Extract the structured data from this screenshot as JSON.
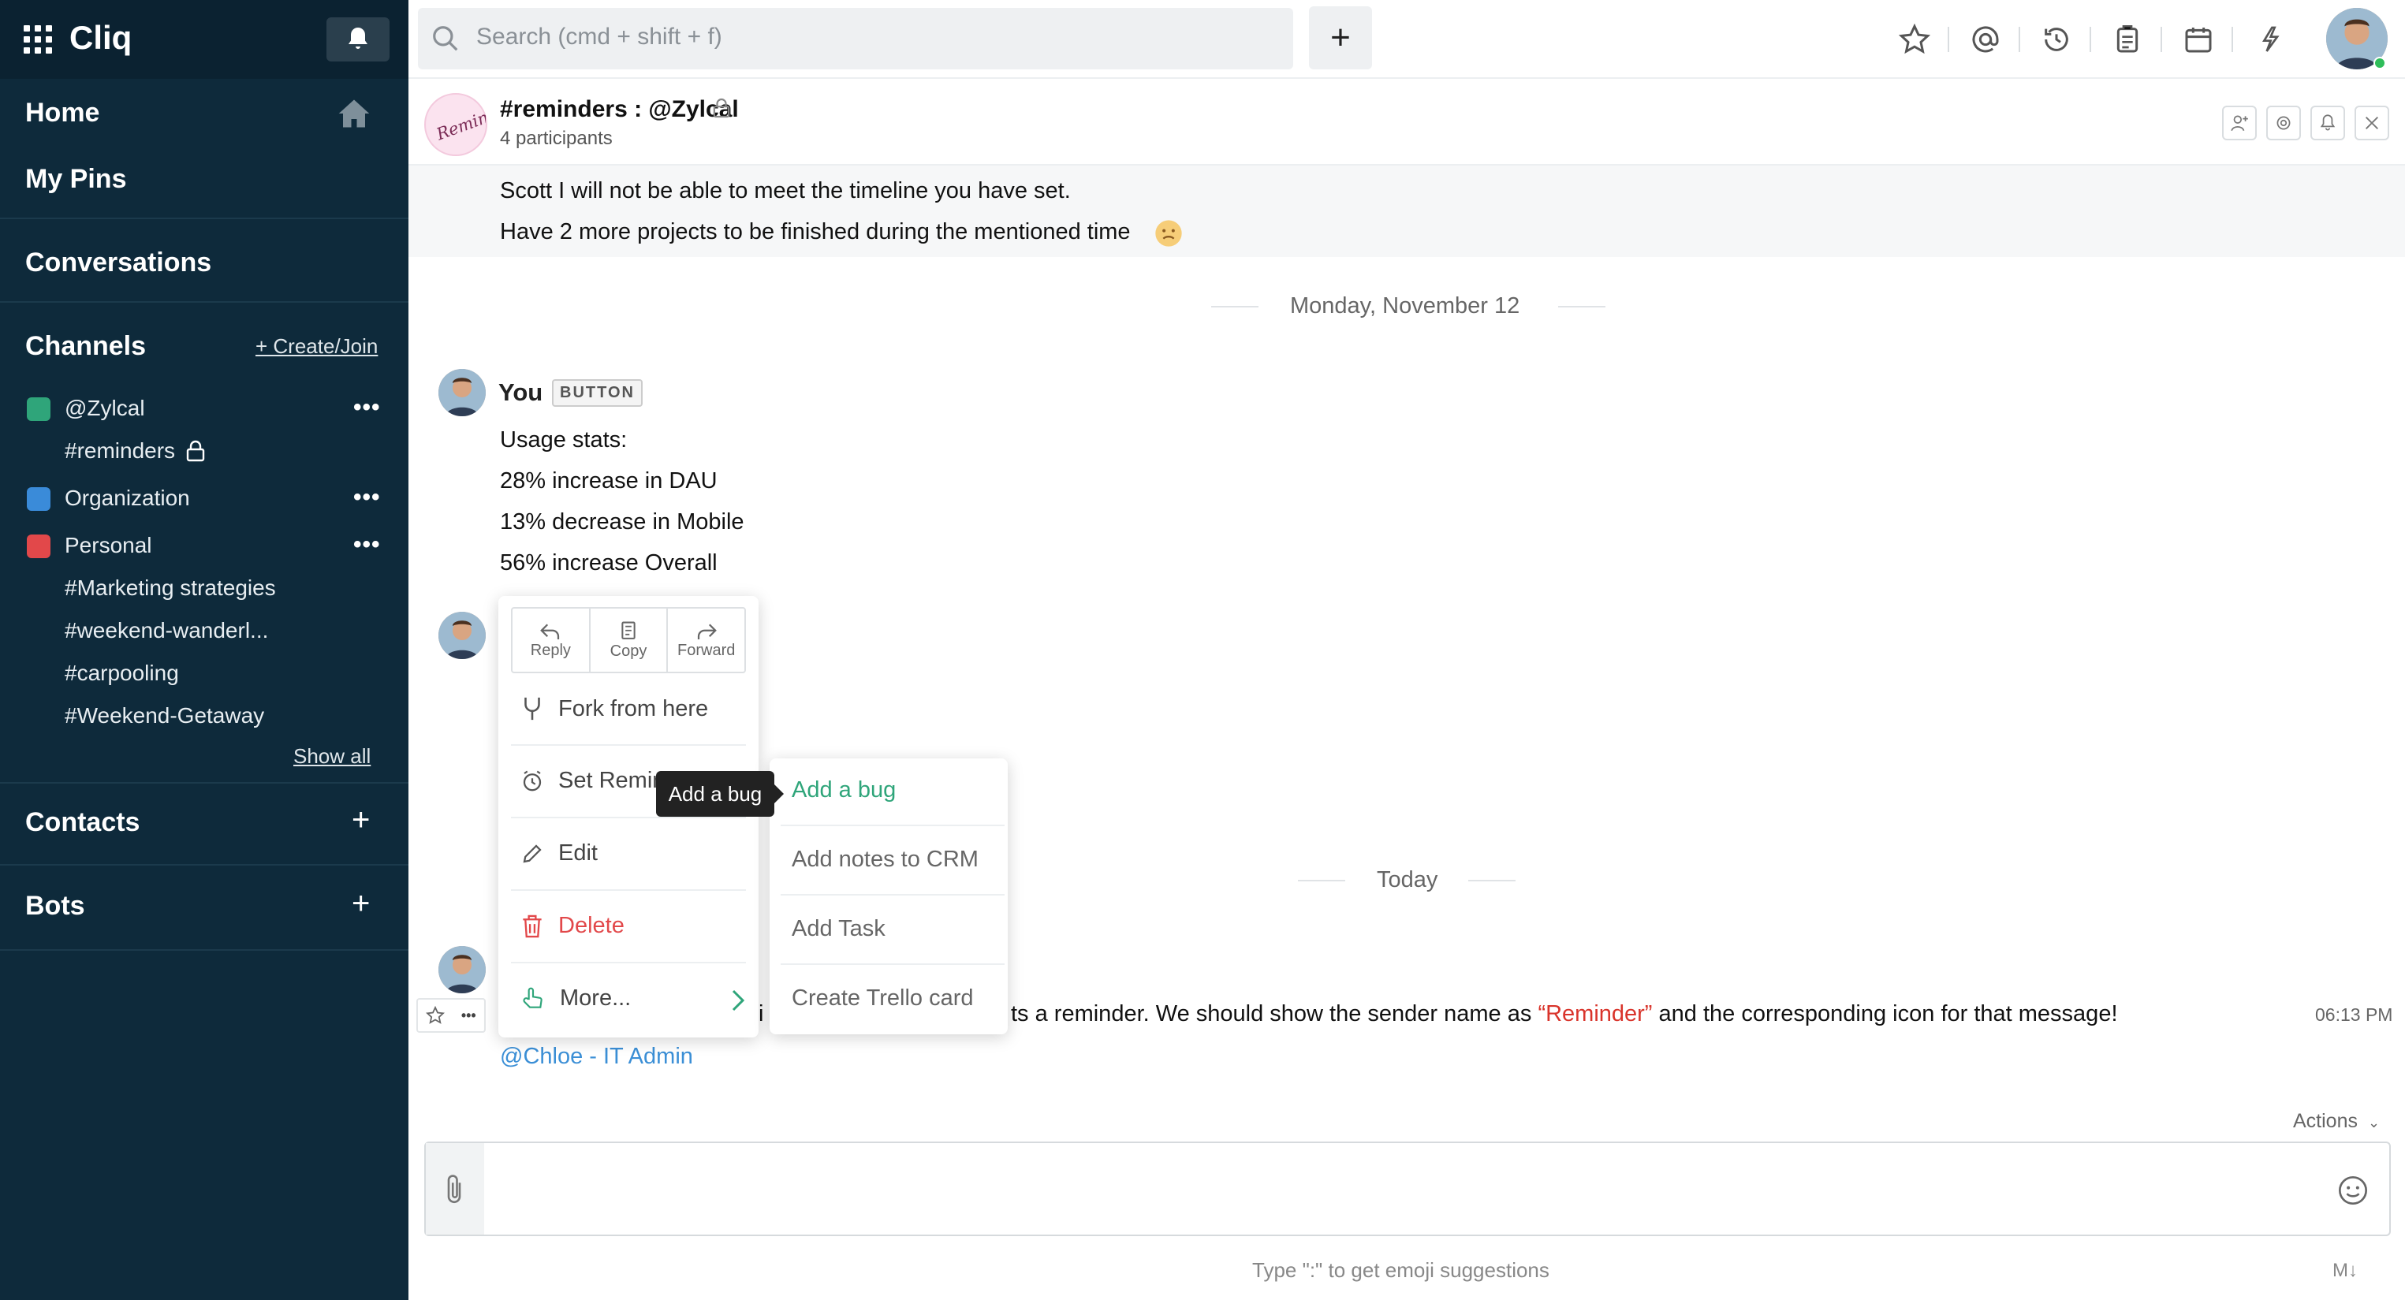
{
  "app": {
    "name": "Cliq"
  },
  "sidebar": {
    "home": "Home",
    "my_pins": "My Pins",
    "conversations": "Conversations",
    "channels": "Channels",
    "create_join": "+ Create/Join",
    "channel_groups": [
      {
        "name": "@Zylcal",
        "color": "#2fa57a"
      },
      {
        "name": "Organization",
        "color": "#3a8bd9"
      },
      {
        "name": "Personal",
        "color": "#e2484a"
      }
    ],
    "zylcal_channels": [
      "#reminders"
    ],
    "personal_channels": [
      "#Marketing strategies",
      "#weekend-wanderl...",
      "#carpooling",
      "#Weekend-Getaway"
    ],
    "show_all": "Show all",
    "contacts": "Contacts",
    "bots": "Bots"
  },
  "topbar": {
    "search_placeholder": "Search (cmd + shift + f)"
  },
  "channel": {
    "title": "#reminders : @Zylcal",
    "participants": "4 participants"
  },
  "messages": {
    "prev_line1": "Scott I will not be able to meet the timeline you have set.",
    "prev_line2": "Have 2 more projects to be finished during the mentioned time",
    "date1": "Monday, November 12",
    "sender": "You",
    "sender_badge": "BUTTON",
    "stats": [
      "Usage stats:",
      "28% increase in DAU",
      "13% decrease in Mobile",
      "56% increase Overall"
    ],
    "date2": "Today",
    "last_msg_prefix": "i",
    "last_msg_a": "ts a reminder. We should show the sender name as",
    "last_msg_quote": "“Reminder”",
    "last_msg_b": "and the corresponding icon for that message!",
    "last_msg_time": "06:13 PM",
    "mention": "@Chloe - IT Admin"
  },
  "context_menu": {
    "reply": "Reply",
    "copy": "Copy",
    "forward": "Forward",
    "fork": "Fork from here",
    "set_reminder": "Set Remin",
    "edit": "Edit",
    "delete": "Delete",
    "more": "More...",
    "tooltip": "Add a bug",
    "submenu": [
      "Add a bug",
      "Add notes to CRM",
      "Add Task",
      "Create Trello card"
    ]
  },
  "composer": {
    "actions": "Actions",
    "hint": "Type \":\" to get emoji suggestions",
    "md": "M↓"
  },
  "colors": {
    "sidebar": "#0e2a3b",
    "accent": "#2fa57a",
    "link": "#3b8fd6",
    "danger": "#e2484a"
  }
}
